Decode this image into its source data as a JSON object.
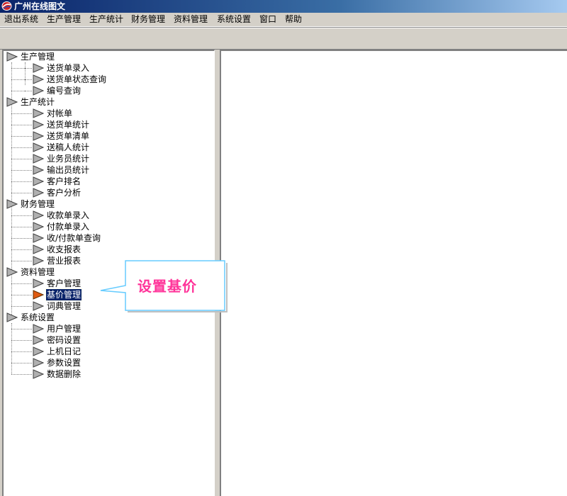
{
  "window": {
    "title": "广州在线图文"
  },
  "menu": [
    "退出系统",
    "生产管理",
    "生产统计",
    "财务管理",
    "资料管理",
    "系统设置",
    "窗口",
    "帮助"
  ],
  "tree": [
    {
      "label": "生产管理",
      "children": [
        "送货单录入",
        "送货单状态查询",
        "编号查询"
      ]
    },
    {
      "label": "生产统计",
      "children": [
        "对帐单",
        "送货单统计",
        "送货单清单",
        "送稿人统计",
        "业务员统计",
        "输出员统计",
        "客户排名",
        "客户分析"
      ]
    },
    {
      "label": "财务管理",
      "children": [
        "收款单录入",
        "付款单录入",
        "收/付款单查询",
        "收支报表",
        "营业报表"
      ]
    },
    {
      "label": "资料管理",
      "children": [
        "客户管理",
        "基价管理",
        "词典管理"
      ]
    },
    {
      "label": "系统设置",
      "children": [
        "用户管理",
        "密码设置",
        "上机日记",
        "参数设置",
        "数据删除"
      ]
    }
  ],
  "selected_item": "基价管理",
  "callout": {
    "text": "设置基价"
  },
  "colors": {
    "selection": "#0a246a",
    "callout_text": "#ff3399",
    "callout_border": "#66ccff",
    "selected_arrow": "#e05a10"
  }
}
